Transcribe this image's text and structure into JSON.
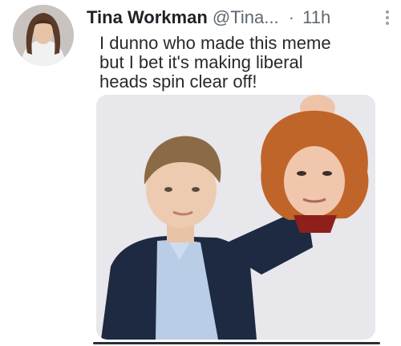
{
  "tweet": {
    "display_name": "Tina Workman",
    "handle": "@Tina...",
    "separator": "·",
    "time": "11h",
    "text": "I dunno who made this meme\nbut I bet it's making liberal\nheads spin clear off!"
  },
  "icons": {
    "avatar": "avatar",
    "more": "more-vertical-icon"
  },
  "colors": {
    "name": "#1e2226",
    "meta": "#5f6770",
    "text": "#262a2e",
    "media_bg": "#e9e8ec"
  }
}
